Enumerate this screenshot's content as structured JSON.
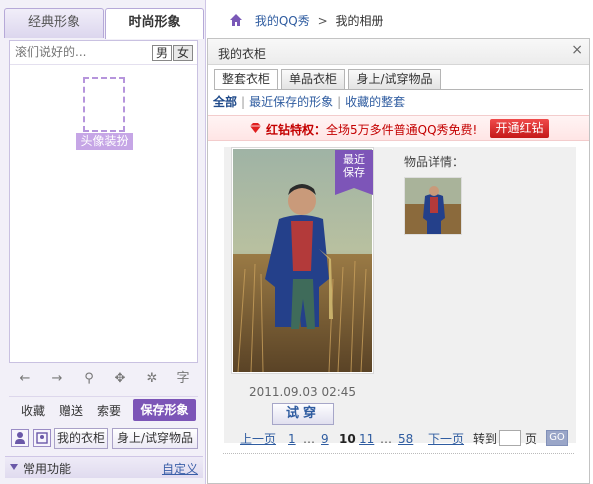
{
  "left_panel": {
    "tabs": [
      "经典形象",
      "时尚形象"
    ],
    "say_placeholder": "滚们说好的...",
    "gender": {
      "male": "男",
      "female": "女"
    },
    "head_label": "头像装扮",
    "tools": [
      {
        "icon": "undo-arrow-icon",
        "glyph": "←"
      },
      {
        "icon": "redo-arrow-icon",
        "glyph": "→"
      },
      {
        "icon": "zoom-icon",
        "glyph": "⚲"
      },
      {
        "icon": "move-icon",
        "glyph": "✥"
      },
      {
        "icon": "magic-wand-icon",
        "glyph": "✲"
      },
      {
        "icon": "text-icon",
        "glyph": "字"
      }
    ],
    "actions": [
      "收藏",
      "赠送",
      "索要"
    ],
    "save_button": "保存形象",
    "bottom": {
      "my_wardrobe": "我的衣柜",
      "on_body": "身上/试穿物品"
    },
    "common": {
      "label": "常用功能",
      "customize": "自定义"
    }
  },
  "breadcrumb": {
    "home": "我的QQ秀",
    "separator": ">",
    "current": "我的相册"
  },
  "dialog": {
    "title": "我的衣柜",
    "close": "×",
    "tabs": [
      "整套衣柜",
      "单品衣柜",
      "身上/试穿物品"
    ],
    "filters": [
      "全部",
      "最近保存的形象",
      "收藏的整套"
    ],
    "promo": {
      "title": "红钻特权：",
      "text": "全场5万多件普通QQ秀免费!",
      "button": "开通红钻"
    },
    "card": {
      "badge": [
        "最近",
        "保存"
      ],
      "date": "2011.09.03 02:45",
      "try_button": "试穿"
    },
    "detail_label": "物品详情：",
    "pager": {
      "prev": "上一页",
      "first": "1",
      "ellipsis": "…",
      "p9": "9",
      "current": "10",
      "p11": "11",
      "last": "58",
      "next": "下一页",
      "goto": "转到",
      "page": "页",
      "go": "GO"
    }
  },
  "colors": {
    "accent_purple": "#7c55b7",
    "link_blue": "#2f5ca0",
    "promo_red": "#c40000"
  }
}
